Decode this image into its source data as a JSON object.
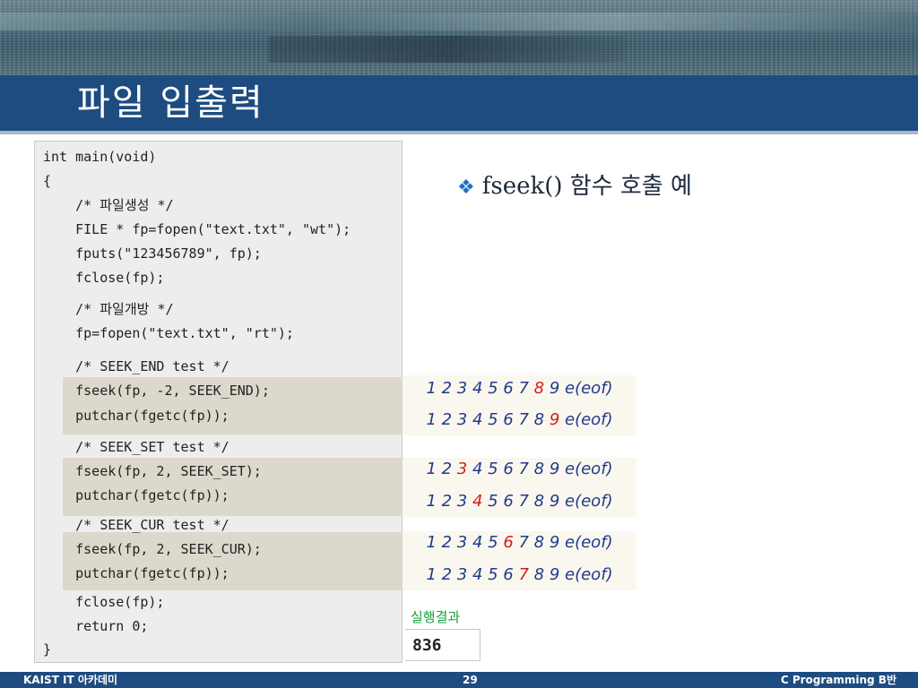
{
  "header": {
    "title": "파일 입출력"
  },
  "code": {
    "lines": [
      "int main(void)",
      "{",
      "    /* 파일생성 */",
      "    FILE * fp=fopen(\"text.txt\", \"wt\");",
      "    fputs(\"123456789\", fp);",
      "    fclose(fp);",
      "    /* 파일개방 */",
      "    fp=fopen(\"text.txt\", \"rt\");",
      "    /* SEEK_END test */",
      "    fseek(fp, -2, SEEK_END);",
      "    putchar(fgetc(fp));",
      "    /* SEEK_SET test */",
      "    fseek(fp, 2, SEEK_SET);",
      "    putchar(fgetc(fp));",
      "    /* SEEK_CUR test */",
      "    fseek(fp, 2, SEEK_CUR);",
      "    putchar(fgetc(fp));",
      "    fclose(fp);",
      "    return 0;",
      "}"
    ]
  },
  "bullet": {
    "text": "fseek() 함수 호출 예"
  },
  "results": [
    {
      "before": "1 2 3 4 5 6 7 ",
      "red": "8",
      "after": " 9 e(eof)"
    },
    {
      "before": "1 2 3 4 5 6 7 8 ",
      "red": "9",
      "after": " e(eof)"
    },
    {
      "before": "1 2 ",
      "red": "3",
      "after": " 4 5 6 7 8 9 e(eof)"
    },
    {
      "before": "1 2 3 ",
      "red": "4",
      "after": " 5 6 7 8 9 e(eof)"
    },
    {
      "before": "1 2 3 4 5 ",
      "red": "6",
      "after": " 7 8 9 e(eof)"
    },
    {
      "before": "1 2 3 4 5 6 ",
      "red": "7",
      "after": " 8 9 e(eof)"
    }
  ],
  "execution": {
    "label": "실행결과",
    "output": "836"
  },
  "footer": {
    "left": "KAIST IT 아카데미",
    "page": "29",
    "right": "C Programming B반"
  }
}
